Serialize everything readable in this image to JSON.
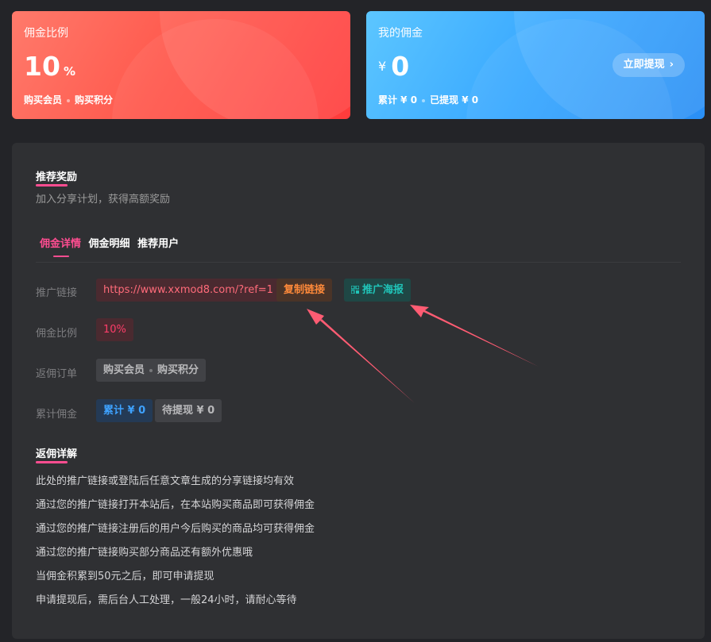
{
  "commission_card": {
    "label": "佣金比例",
    "value": "10",
    "unit": "%",
    "tag1": "购买会员",
    "tag2": "购买积分",
    "color": "#ff4a45"
  },
  "my_commission_card": {
    "label": "我的佣金",
    "currency": "¥",
    "value": "0",
    "total": "累计 ¥ 0",
    "withdrawn": "已提现 ¥ 0",
    "withdraw_button": "立即提现",
    "color": "#39a8ff"
  },
  "referral": {
    "title": "推荐奖励",
    "description": "加入分享计划，获得高额奖励",
    "tabs": [
      {
        "label": "佣金详情",
        "active": true
      },
      {
        "label": "佣金明细",
        "active": false
      },
      {
        "label": "推荐用户",
        "active": false
      }
    ],
    "rows": {
      "link_label": "推广链接",
      "link_value": "https://www.xxmod8.com/?ref=1",
      "copy_button": "复制链接",
      "poster_button": "推广海报",
      "ratio_label": "佣金比例",
      "ratio_value": "10%",
      "orders_label": "返佣订单",
      "orders_tag1": "购买会员",
      "orders_tag2": "购买积分",
      "total_label": "累计佣金",
      "total_value": "累计 ¥ 0",
      "pending_value": "待提现 ¥ 0"
    }
  },
  "details": {
    "title": "返佣详解",
    "items": [
      "此处的推广链接或登陆后任意文章生成的分享链接均有效",
      "通过您的推广链接打开本站后，在本站购买商品即可获得佣金",
      "通过您的推广链接注册后的用户今后购买的商品均可获得佣金",
      "通过您的推广链接购买部分商品还有额外优惠哦",
      "当佣金积累到50元之后，即可申请提现",
      "申请提现后，需后台人工处理，一般24小时，请耐心等待"
    ]
  },
  "accent_color": "#ff4d91"
}
